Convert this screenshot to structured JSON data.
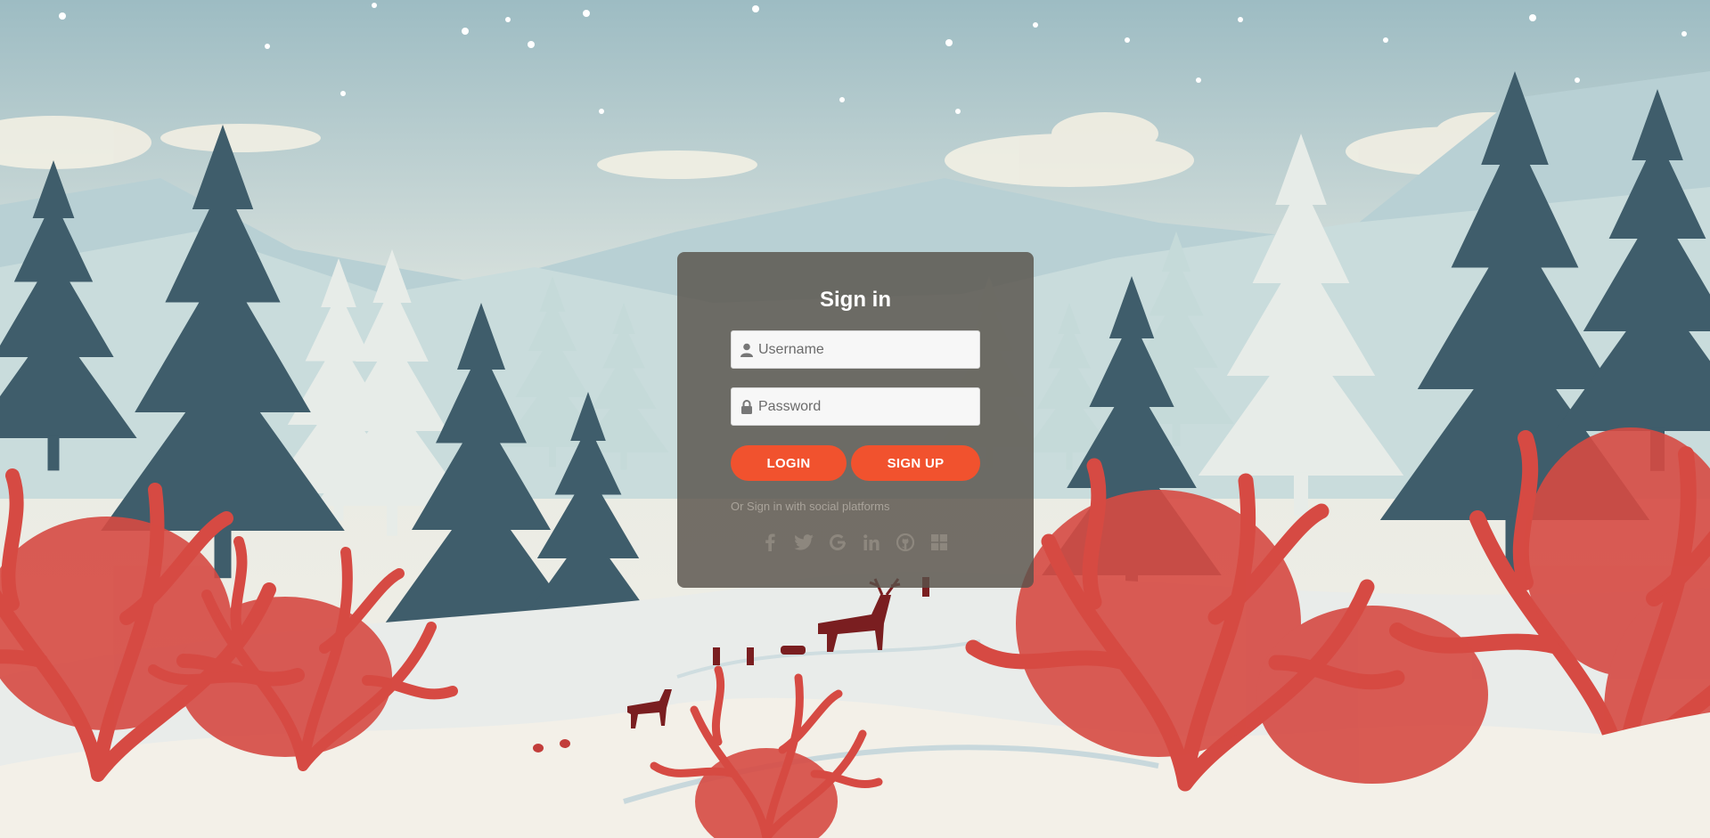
{
  "login": {
    "title": "Sign in",
    "username_placeholder": "Username",
    "password_placeholder": "Password",
    "login_label": "LOGIN",
    "signup_label": "SIGN UP",
    "social_text": "Or Sign in with social platforms",
    "social_icons": [
      "facebook-icon",
      "twitter-icon",
      "google-icon",
      "linkedin-icon",
      "github-icon",
      "windows-icon"
    ]
  },
  "colors": {
    "accent": "#f1522e",
    "card": "#58524a",
    "sky": "#a9c3c9",
    "pine": "#3f5d6b",
    "coral": "#d64a43",
    "snow": "#efece4"
  }
}
